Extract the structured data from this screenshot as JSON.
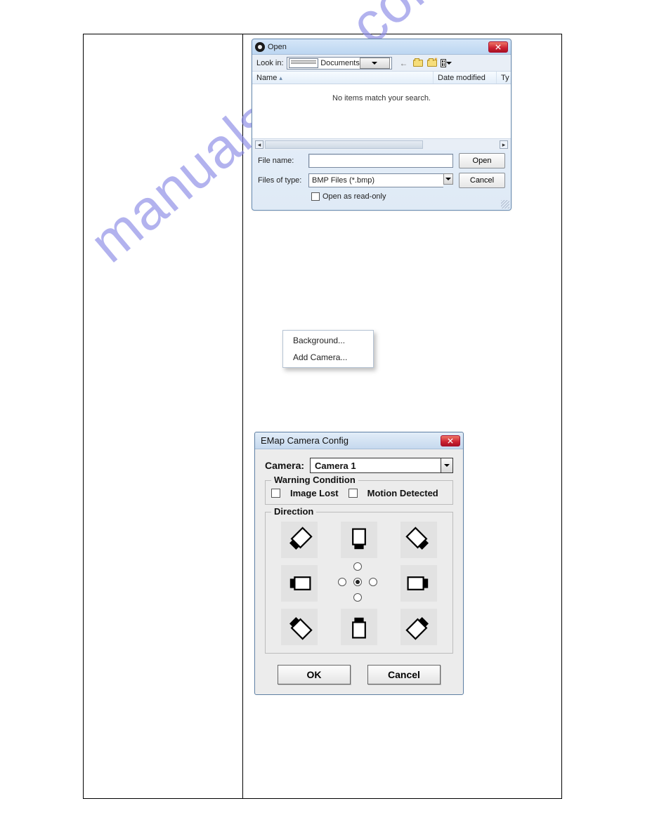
{
  "watermark": "manualshive.com",
  "openDialog": {
    "title": "Open",
    "lookInLabel": "Look in:",
    "lookInValue": "Documents",
    "columns": {
      "name": "Name",
      "date": "Date modified",
      "type": "Ty"
    },
    "emptyMsg": "No items match your search.",
    "fileNameLabel": "File name:",
    "fileNameValue": "",
    "filesOfTypeLabel": "Files of type:",
    "filesOfTypeValue": "BMP Files (*.bmp)",
    "openBtn": "Open",
    "cancelBtn": "Cancel",
    "readOnlyLabel": "Open as read-only"
  },
  "contextMenu": {
    "background": "Background...",
    "addCamera": "Add Camera..."
  },
  "emap": {
    "title": "EMap Camera Config",
    "cameraLabel": "Camera:",
    "cameraValue": "Camera 1",
    "warningLegend": "Warning Condition",
    "imageLost": "Image Lost",
    "motionDetected": "Motion Detected",
    "directionLegend": "Direction",
    "okBtn": "OK",
    "cancelBtn": "Cancel"
  }
}
